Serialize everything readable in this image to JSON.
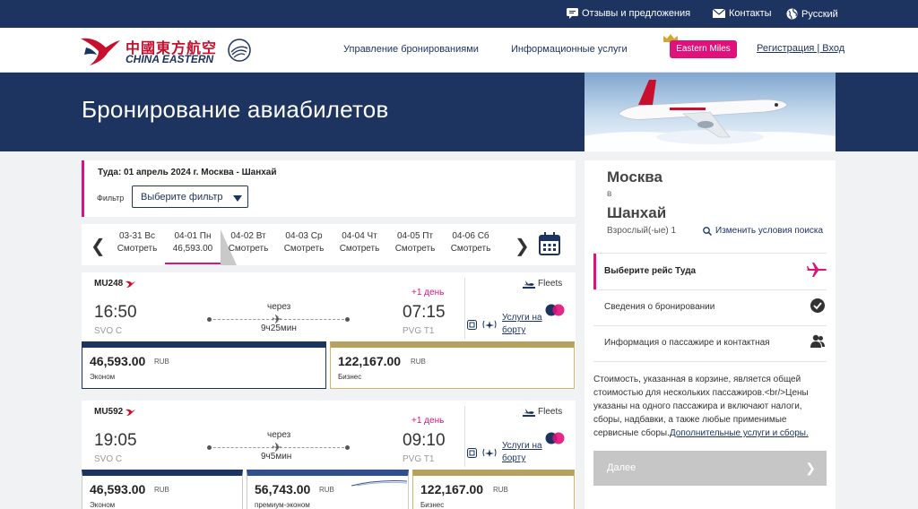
{
  "topbar": {
    "feedback": "Отзывы и предложения",
    "contacts": "Контакты",
    "language": "Русский"
  },
  "header": {
    "logo_cn": "中國東方航空",
    "logo_en": "CHINA EASTERN",
    "nav_manage": "Управление бронированиями",
    "nav_info": "Информационные услуги",
    "eastern_miles": "Eastern Miles",
    "login": "Регистрация | Вход"
  },
  "hero": {
    "title": "Бронирование авиабилетов"
  },
  "search": {
    "title": "Туда: 01 апрель 2024 г. Москва - Шанхай",
    "filter_label": "Фильтр",
    "filter_value": "Выберите фильтр"
  },
  "dates": [
    {
      "date": "03-31 Вс",
      "price": "Смотреть"
    },
    {
      "date": "04-01 Пн",
      "price": "46,593.00"
    },
    {
      "date": "04-02 Вт",
      "price": "Смотреть"
    },
    {
      "date": "04-03 Ср",
      "price": "Смотреть"
    },
    {
      "date": "04-04 Чт",
      "price": "Смотреть"
    },
    {
      "date": "04-05 Пт",
      "price": "Смотреть"
    },
    {
      "date": "04-06 Сб",
      "price": "Смотреть"
    }
  ],
  "flights": [
    {
      "number": "MU248",
      "dep_time": "16:50",
      "dep_airport": "SVO C",
      "via": "через",
      "duration": "9ч25мин",
      "plus_day": "+1 день",
      "arr_time": "07:15",
      "arr_airport": "PVG T1",
      "fleets": "Fleets",
      "services": "Услуги на борту",
      "fares": [
        {
          "price": "46,593.00",
          "currency": "RUB",
          "class": "Эконом"
        },
        {
          "price": "122,167.00",
          "currency": "RUB",
          "class": "Бизнес"
        }
      ]
    },
    {
      "number": "MU592",
      "dep_time": "19:05",
      "dep_airport": "SVO C",
      "via": "через",
      "duration": "9ч5мин",
      "plus_day": "+1 день",
      "arr_time": "09:10",
      "arr_airport": "PVG T1",
      "fleets": "Fleets",
      "services": "Услуги на борту",
      "fares": [
        {
          "price": "46,593.00",
          "currency": "RUB",
          "class": "Эконом"
        },
        {
          "price": "56,743.00",
          "currency": "RUB",
          "class": "премиум-эконом"
        },
        {
          "price": "122,167.00",
          "currency": "RUB",
          "class": "Бизнес"
        }
      ]
    }
  ],
  "summary": {
    "from": "Москва",
    "to_word": "в",
    "to": "Шанхай",
    "passengers": "Взрослый(-ые) 1",
    "modify": "Изменить условия поиска",
    "steps": [
      "Выберите рейс Туда",
      "Сведения о бронировании",
      "Информация о пассажире и контактная"
    ],
    "note": "Стоимость, указанная в корзине, является общей стоимостью для нескольких пассажиров.<br/>Цены указаны на одного пассажира и включают налоги, сборы, надбавки, а также любые применимые сервисные сборы.",
    "note_link": "Дополнительные услуги и сборы.",
    "next_button": "Далее",
    "next_arrow": "❯"
  },
  "colors": {
    "navy": "#1d3461",
    "magenta": "#e0117a",
    "gold": "#b5a25f",
    "disabled": "#c6c6c6"
  }
}
